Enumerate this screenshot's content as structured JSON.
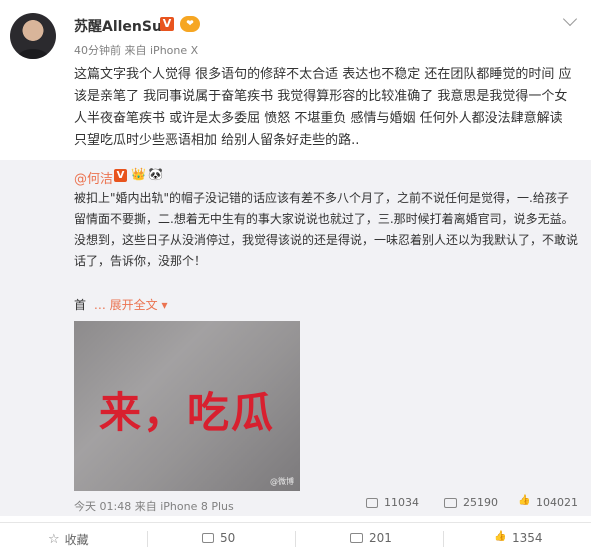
{
  "post": {
    "author": "苏醒AllenSu",
    "time": "40分钟前",
    "source_prefix": "来自",
    "device": "iPhone X",
    "text": "这篇文字我个人觉得 很多语句的修辞不太合适 表达也不稳定 还在团队都睡觉的时间 应该是亲笔了 我同事说属于奋笔疾书 我觉得算形容的比较准确了 我意思是我觉得一个女人半夜奋笔疾书 或许是太多委屈 愤怒 不堪重负 感情与婚姻 任何外人都没法肆意解读 只望吃瓜时少些恶语相加 给别人留条好走些的路.."
  },
  "repost": {
    "author": "@何洁",
    "text": "被扣上\"婚内出轨\"的帽子没记错的话应该有差不多八个月了，之前不说任何是觉得，一.给孩子留情面不要撕，二.想着无中生有的事大家说说也就过了，三.那时候打着离婚官司，说多无益。没想到，这些日子从没消停过，我觉得该说的还是得说，一味忍着别人还以为我默认了，不敢说话了，告诉你，没那个！",
    "more_prefix": "首",
    "more_link": "展开全文",
    "image_caption": "来，吃瓜",
    "image_watermark": "@微博",
    "time": "今天 01:48",
    "source_prefix": "来自",
    "device": "iPhone 8 Plus",
    "shares": "11034",
    "comments": "25190",
    "likes": "104021"
  },
  "actions": {
    "favorite": "收藏",
    "share": "50",
    "comment": "201",
    "like": "1354"
  },
  "colors": {
    "link": "#eb7350",
    "verified": "#e8541e",
    "repost_bg": "#f2f2f5"
  }
}
